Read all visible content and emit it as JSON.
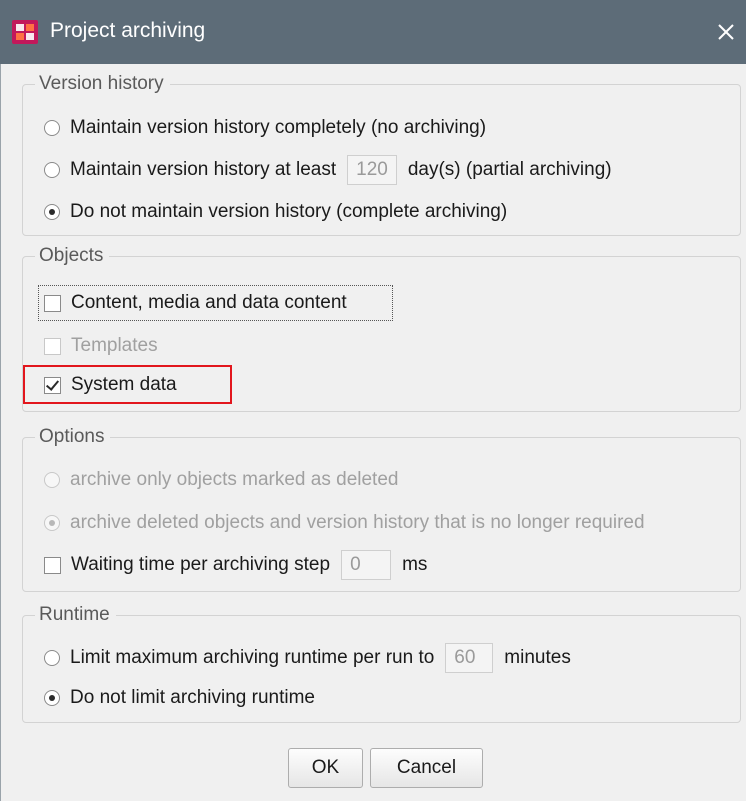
{
  "window": {
    "title": "Project archiving",
    "app_icon": "firstspirit-app-icon",
    "close_icon": "close-x-icon",
    "highlight_color": "#e2161d"
  },
  "version_history": {
    "legend": "Version history",
    "opt_complete_label": "Maintain version history completely (no archiving)",
    "opt_partial_prefix": "Maintain version history at least",
    "opt_partial_days": "120",
    "opt_partial_suffix": "day(s) (partial archiving)",
    "opt_none_label": "Do not maintain version history (complete archiving)"
  },
  "objects": {
    "legend": "Objects",
    "content_label": "Content, media and data content",
    "templates_label": "Templates",
    "system_label": "System data"
  },
  "options": {
    "legend": "Options",
    "deleted_only_label": "archive only objects marked as deleted",
    "deleted_and_history_label": "archive deleted objects and version history that is no longer required",
    "waiting_prefix": "Waiting time per archiving step",
    "waiting_value": "0",
    "waiting_suffix": "ms"
  },
  "runtime": {
    "legend": "Runtime",
    "limit_prefix": "Limit maximum archiving runtime per run to",
    "limit_value": "60",
    "limit_suffix": "minutes",
    "nolimit_label": "Do not limit archiving runtime"
  },
  "buttons": {
    "ok_label": "OK",
    "cancel_label": "Cancel"
  }
}
